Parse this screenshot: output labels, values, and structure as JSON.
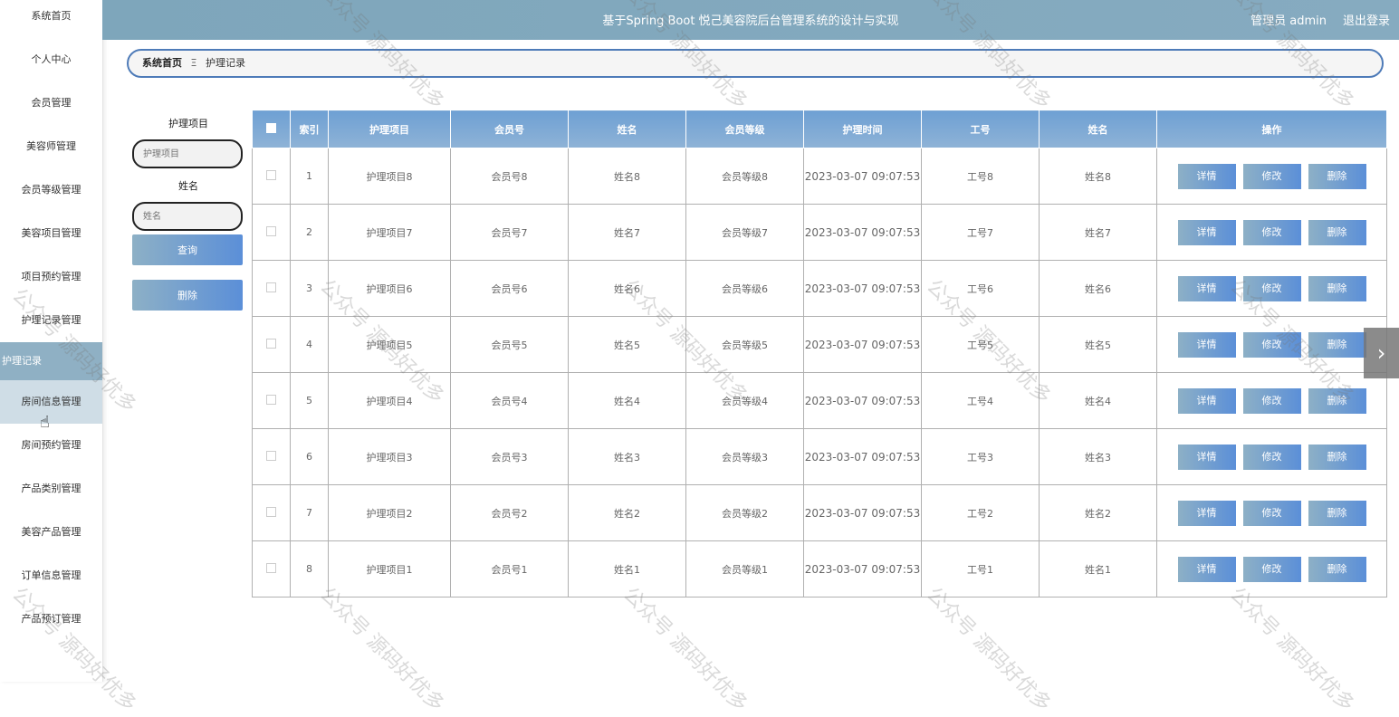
{
  "header": {
    "title": "基于Spring Boot 悦己美容院后台管理系统的设计与实现",
    "user": "管理员 admin",
    "logout": "退出登录"
  },
  "sidebar": {
    "items": [
      {
        "label": "系统首页"
      },
      {
        "label": "个人中心"
      },
      {
        "label": "会员管理"
      },
      {
        "label": "美容师管理"
      },
      {
        "label": "会员等级管理"
      },
      {
        "label": "美容项目管理"
      },
      {
        "label": "项目预约管理"
      },
      {
        "label": "护理记录管理"
      },
      {
        "label": "护理记录"
      },
      {
        "label": "房间信息管理"
      },
      {
        "label": "房间预约管理"
      },
      {
        "label": "产品类别管理"
      },
      {
        "label": "美容产品管理"
      },
      {
        "label": "订单信息管理"
      },
      {
        "label": "产品预订管理"
      }
    ]
  },
  "breadcrumb": {
    "home": "系统首页",
    "separator": "Ξ",
    "current": "护理记录"
  },
  "search": {
    "field1_label": "护理项目",
    "field1_placeholder": "护理项目",
    "field2_label": "姓名",
    "field2_placeholder": "姓名",
    "query_button": "查询",
    "delete_button": "删除"
  },
  "table": {
    "headers": [
      "索引",
      "护理项目",
      "会员号",
      "姓名",
      "会员等级",
      "护理时间",
      "工号",
      "姓名",
      "操作"
    ],
    "rows": [
      {
        "index": "1",
        "item": "护理项目8",
        "member_no": "会员号8",
        "name": "姓名8",
        "level": "会员等级8",
        "time": "2023-03-07 09:07:53",
        "staff_no": "工号8",
        "staff_name": "姓名8"
      },
      {
        "index": "2",
        "item": "护理项目7",
        "member_no": "会员号7",
        "name": "姓名7",
        "level": "会员等级7",
        "time": "2023-03-07 09:07:53",
        "staff_no": "工号7",
        "staff_name": "姓名7"
      },
      {
        "index": "3",
        "item": "护理项目6",
        "member_no": "会员号6",
        "name": "姓名6",
        "level": "会员等级6",
        "time": "2023-03-07 09:07:53",
        "staff_no": "工号6",
        "staff_name": "姓名6"
      },
      {
        "index": "4",
        "item": "护理项目5",
        "member_no": "会员号5",
        "name": "姓名5",
        "level": "会员等级5",
        "time": "2023-03-07 09:07:53",
        "staff_no": "工号5",
        "staff_name": "姓名5"
      },
      {
        "index": "5",
        "item": "护理项目4",
        "member_no": "会员号4",
        "name": "姓名4",
        "level": "会员等级4",
        "time": "2023-03-07 09:07:53",
        "staff_no": "工号4",
        "staff_name": "姓名4"
      },
      {
        "index": "6",
        "item": "护理项目3",
        "member_no": "会员号3",
        "name": "姓名3",
        "level": "会员等级3",
        "time": "2023-03-07 09:07:53",
        "staff_no": "工号3",
        "staff_name": "姓名3"
      },
      {
        "index": "7",
        "item": "护理项目2",
        "member_no": "会员号2",
        "name": "姓名2",
        "level": "会员等级2",
        "time": "2023-03-07 09:07:53",
        "staff_no": "工号2",
        "staff_name": "姓名2"
      },
      {
        "index": "8",
        "item": "护理项目1",
        "member_no": "会员号1",
        "name": "姓名1",
        "level": "会员等级1",
        "time": "2023-03-07 09:07:53",
        "staff_no": "工号1",
        "staff_name": "姓名1"
      }
    ],
    "actions": {
      "detail": "详情",
      "edit": "修改",
      "delete": "删除"
    }
  },
  "watermark": "公众号 源码好优多",
  "colors": {
    "header": "#7ea6bb",
    "active_menu": "#8fb0c4",
    "button_start": "#8db0c6",
    "button_end": "#5b8fd8",
    "table_head": "#6ea0d4"
  }
}
